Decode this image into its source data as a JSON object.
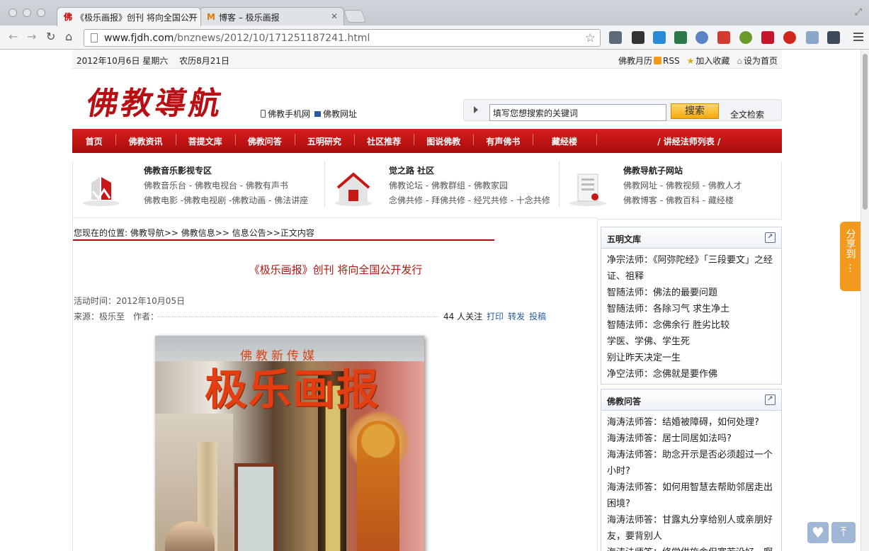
{
  "browser": {
    "tabs": [
      {
        "label": "《极乐画报》创刊 将向全国公开",
        "favicon": "佛"
      },
      {
        "label": "博客 – 极乐画报",
        "favicon": "M"
      }
    ],
    "url_domain": "www.fjdh.com",
    "url_path": "/bnznews/2012/10/171251187241.html"
  },
  "topbar": {
    "date": "2012年10月6日 星期六　 农历8月21日",
    "links": [
      "佛教月历",
      "RSS",
      "加入收藏",
      "设为首页"
    ]
  },
  "header": {
    "logo": "佛教導航",
    "mobile_links": [
      "佛教手机网",
      "佛教网址"
    ],
    "search": {
      "placeholder": "填写您想搜索的关键词",
      "button": "搜索",
      "all_search": "全文检索"
    }
  },
  "nav": {
    "items": [
      "首页",
      "佛教资讯",
      "菩提文库",
      "佛教问答",
      "五明研究",
      "社区推荐",
      "图说佛教",
      "有声佛书",
      "藏经楼",
      "/ 讲经法师列表 /"
    ]
  },
  "features": [
    {
      "title": "佛教音乐影视专区",
      "line1": "佛教音乐台 - 佛教电视台 - 佛教有声书",
      "line2": "佛教电影 -佛教电视剧 -佛教动画 - 佛法讲座"
    },
    {
      "title": "觉之路 社区",
      "line1": "佛教论坛 - 佛教群组 - 佛教家园",
      "line2": "念佛共修 - 拜佛共修 - 经咒共修 - 十念共修"
    },
    {
      "title": "佛教导航子网站",
      "line1": "佛教网址 - 佛教视频 - 佛教人才",
      "line2": "佛教博客 - 佛教百科 - 藏经楼"
    }
  ],
  "article": {
    "breadcrumb": "您现在的位置: 佛教导航>> 佛教信息>> 信息公告>>正文内容",
    "title": "《极乐画报》创刊 将向全国公开发行",
    "time": "活动时间：2012年10月05日",
    "source": "来源：极乐至　作者：",
    "followers": "44 人关注",
    "tools": [
      "打印",
      "转发",
      "投稿"
    ],
    "poster_kicker": "佛教新传媒",
    "poster_title": "极乐画报"
  },
  "sidebar": {
    "wuming": {
      "title": "五明文库",
      "items": [
        "净宗法师：《阿弥陀经》「三段要文」之经证、祖释",
        "智随法师：佛法的最要问题",
        "智随法师：各除习气 求生净土",
        "智随法师：念佛余行 胜劣比较",
        "学医、学佛、学生死",
        "别让昨天决定一生",
        "净空法师：念佛就是要作佛"
      ]
    },
    "wenda": {
      "title": "佛教问答",
      "items": [
        "海涛法师答：结婚被障碍，如何处理?",
        "海涛法师答：居士同居如法吗?",
        "海涛法师答：助念开示是否必须超过一个小时?",
        "海涛法师答：如何用智慧去帮助邻居走出困境?",
        "海涛法师答：甘露丸分享给别人或亲朋好友，要背别人",
        "海涛法师答：修觉供施舍但宽若没好，啊"
      ]
    }
  },
  "share_label": "分享到",
  "colors": {
    "brand_red": "#b80f14",
    "nav_red": "#c41616",
    "share_orange": "#f39a1e",
    "link_blue": "#2a5a9c"
  }
}
